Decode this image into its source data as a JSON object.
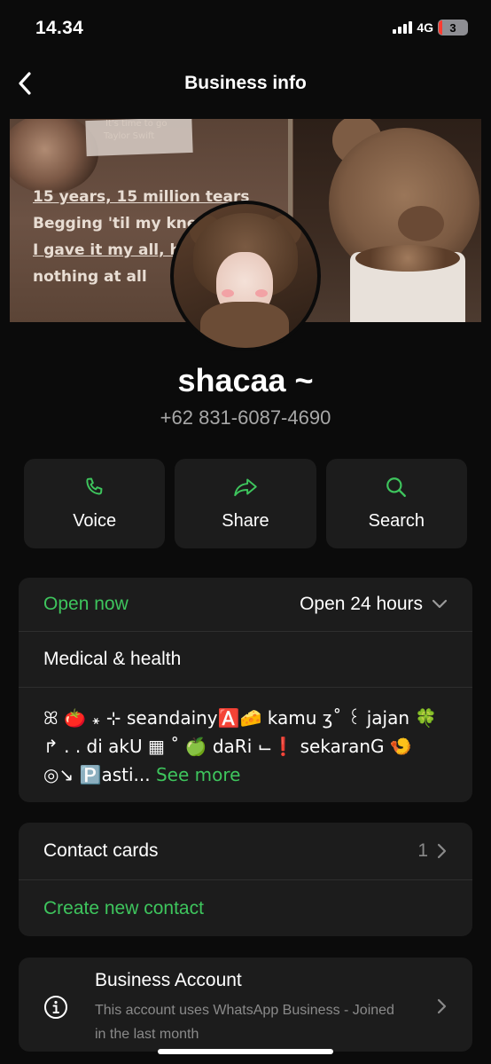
{
  "status_bar": {
    "time": "14.34",
    "network": "4G",
    "battery": "3"
  },
  "header": {
    "title": "Business info"
  },
  "cover": {
    "lines": [
      "It's time to go",
      "Taylor Swift",
      "15 years, 15 million tears",
      "Begging 'til my knees",
      "I gave it my all, he",
      "nothing at all"
    ]
  },
  "profile": {
    "name": "shacaa ~",
    "phone": "+62 831-6087-4690"
  },
  "actions": [
    {
      "label": "Voice",
      "icon": "phone-icon"
    },
    {
      "label": "Share",
      "icon": "share-icon"
    },
    {
      "label": "Search",
      "icon": "search-icon"
    }
  ],
  "hours": {
    "status": "Open now",
    "summary": "Open 24 hours"
  },
  "category": "Medical & health",
  "description": {
    "text": "ꕤ 🍅 ꘎ ⊹ seandainy🅰️🧀 kamu ʒ˚ ꒰ jajan 🍀 ↱ . . di akU ▦ ˚ 🍏 daRi ⌙❗ sekaranG 🍤 ◎↘ 🅿️asti...",
    "see_more": "See more"
  },
  "contacts": {
    "label": "Contact cards",
    "count": "1",
    "create_label": "Create new contact"
  },
  "business_account": {
    "title": "Business Account",
    "subtitle": "This account uses WhatsApp Business - Joined in the last month"
  },
  "colors": {
    "accent": "#3ec55d",
    "background": "#0b0b0b",
    "card": "#1c1c1c"
  }
}
